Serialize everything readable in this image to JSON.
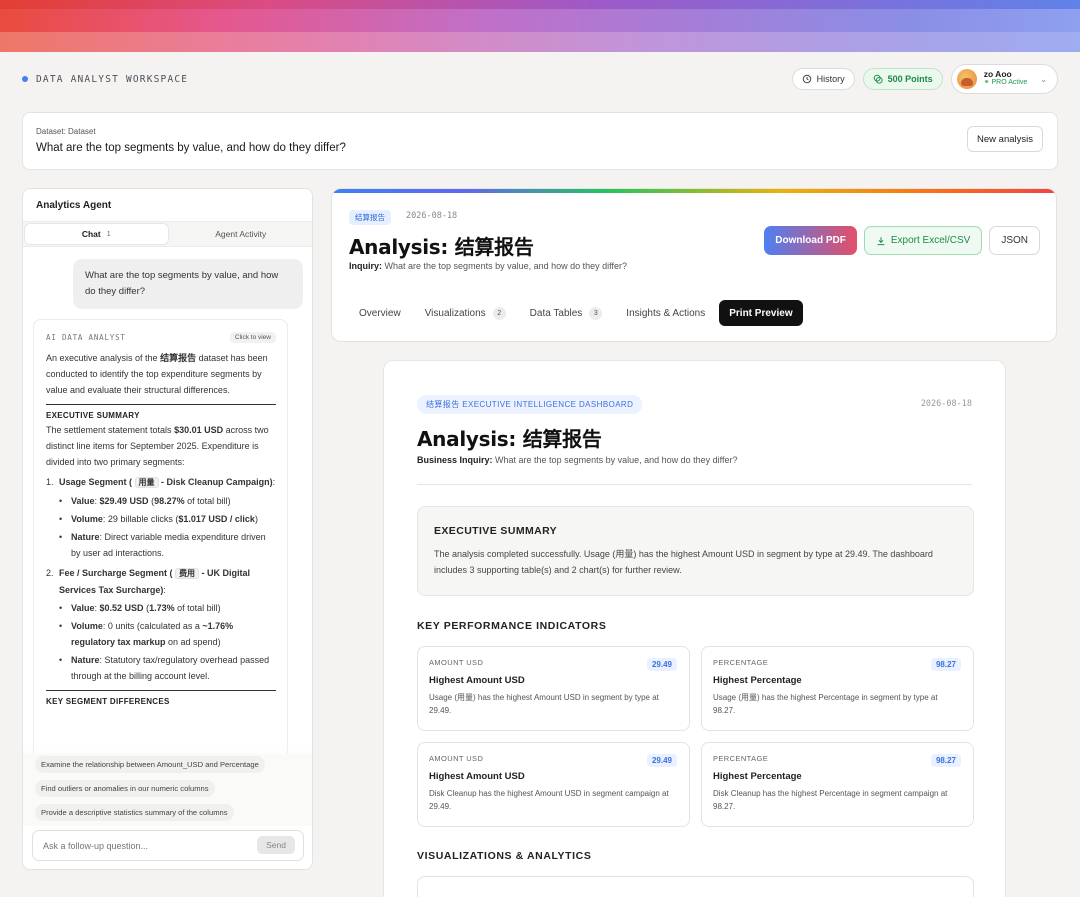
{
  "workspace": {
    "title": "DATA ANALYST WORKSPACE"
  },
  "topbar": {
    "history_label": "History",
    "points_label": "500 Points",
    "user_name": "zo Aoo",
    "user_status": "PRO Active"
  },
  "dataset": {
    "label": "Dataset: Dataset",
    "question": "What are the top segments by value, and how do they differ?",
    "new_analysis_label": "New analysis"
  },
  "agent": {
    "title": "Analytics Agent",
    "tabs": [
      {
        "label": "Chat",
        "count": "1"
      },
      {
        "label": "Agent Activity"
      }
    ],
    "user_message": "What are the top segments by value, and how do they differ?",
    "ai": {
      "label": "AI DATA ANALYST",
      "click_to_view": "Click to view",
      "intro_pre": "An executive analysis of the ",
      "intro_bold": "结算报告",
      "intro_post": " dataset has been conducted to identify the top expenditure segments by value and evaluate their structural differences.",
      "exec_heading": "EXECUTIVE SUMMARY",
      "exec_pre": "The settlement statement totals ",
      "exec_bold": "$30.01 USD",
      "exec_post": " across two distinct line items for September 2025. Expenditure is divided into two primary segments:",
      "seg1_num": "1.",
      "seg1_pre": "Usage Segment (",
      "seg1_chip": "用量",
      "seg1_post": " - Disk Cleanup Campaign)",
      "seg1_colon": ":",
      "seg1_b1_label": "Value",
      "seg1_b1_pre": ": ",
      "seg1_b1_bold": "$29.49 USD",
      "seg1_b1_mid": " (",
      "seg1_b1_bold2": "98.27%",
      "seg1_b1_post": " of total bill)",
      "seg1_b2_label": "Volume",
      "seg1_b2_pre": ": 29 billable clicks (",
      "seg1_b2_bold": "$1.017 USD / click",
      "seg1_b2_post": ")",
      "seg1_b3_label": "Nature",
      "seg1_b3_text": ": Direct variable media expenditure driven by user ad interactions.",
      "seg2_num": "2.",
      "seg2_pre": "Fee / Surcharge Segment (",
      "seg2_chip": "费用",
      "seg2_post": " - UK Digital Services Tax Surcharge)",
      "seg2_colon": ":",
      "seg2_b1_label": "Value",
      "seg2_b1_pre": ": ",
      "seg2_b1_bold": "$0.52 USD",
      "seg2_b1_mid": " (",
      "seg2_b1_bold2": "1.73%",
      "seg2_b1_post": " of total bill)",
      "seg2_b2_label": "Volume",
      "seg2_b2_pre": ": 0 units (calculated as a ",
      "seg2_b2_bold": "~1.76% regulatory tax markup",
      "seg2_b2_post": " on ad spend)",
      "seg2_b3_label": "Nature",
      "seg2_b3_text": ": Statutory tax/regulatory overhead passed through at the billing account level.",
      "key_diff_heading": "KEY SEGMENT DIFFERENCES"
    },
    "suggestions": [
      "Examine the relationship between Amount_USD and Percentage",
      "Find outliers or anomalies in our numeric columns",
      "Provide a descriptive statistics summary of the columns"
    ],
    "composer_placeholder": "Ask a follow-up question...",
    "send_label": "Send"
  },
  "header": {
    "tag": "结算报告",
    "date": "2026-08-18",
    "title": "Analysis: 结算报告",
    "inquiry_label": "Inquiry:",
    "inquiry_text": "What are the top segments by value, and how do they differ?",
    "download_pdf": "Download PDF",
    "export_excel": "Export Excel/CSV",
    "json": "JSON",
    "tabs": [
      {
        "label": "Overview"
      },
      {
        "label": "Visualizations",
        "count": "2"
      },
      {
        "label": "Data Tables",
        "count": "3"
      },
      {
        "label": "Insights & Actions"
      },
      {
        "label": "Print Preview"
      }
    ]
  },
  "report": {
    "tag": "结算报告 EXECUTIVE INTELLIGENCE DASHBOARD",
    "date": "2026-08-18",
    "title": "Analysis: 结算报告",
    "inquiry_label": "Business Inquiry:",
    "inquiry_text": "What are the top segments by value, and how do they differ?",
    "exec_heading": "EXECUTIVE SUMMARY",
    "exec_text": "The analysis completed successfully. Usage (用量) has the highest Amount USD in segment by type at 29.49. The dashboard includes 3 supporting table(s) and 2 chart(s) for further review.",
    "kpi_heading": "KEY PERFORMANCE INDICATORS",
    "kpis": [
      {
        "label": "AMOUNT USD",
        "value": "29.49",
        "title": "Highest Amount USD",
        "desc": "Usage (用量) has the highest Amount USD in segment by type at 29.49."
      },
      {
        "label": "PERCENTAGE",
        "value": "98.27",
        "title": "Highest Percentage",
        "desc": "Usage (用量) has the highest Percentage in segment by type at 98.27."
      },
      {
        "label": "AMOUNT USD",
        "value": "29.49",
        "title": "Highest Amount USD",
        "desc": "Disk Cleanup has the highest Amount USD in segment campaign at 29.49."
      },
      {
        "label": "PERCENTAGE",
        "value": "98.27",
        "title": "Highest Percentage",
        "desc": "Disk Cleanup has the highest Percentage in segment campaign at 98.27."
      }
    ],
    "viz_heading": "VISUALIZATIONS & ANALYTICS"
  }
}
